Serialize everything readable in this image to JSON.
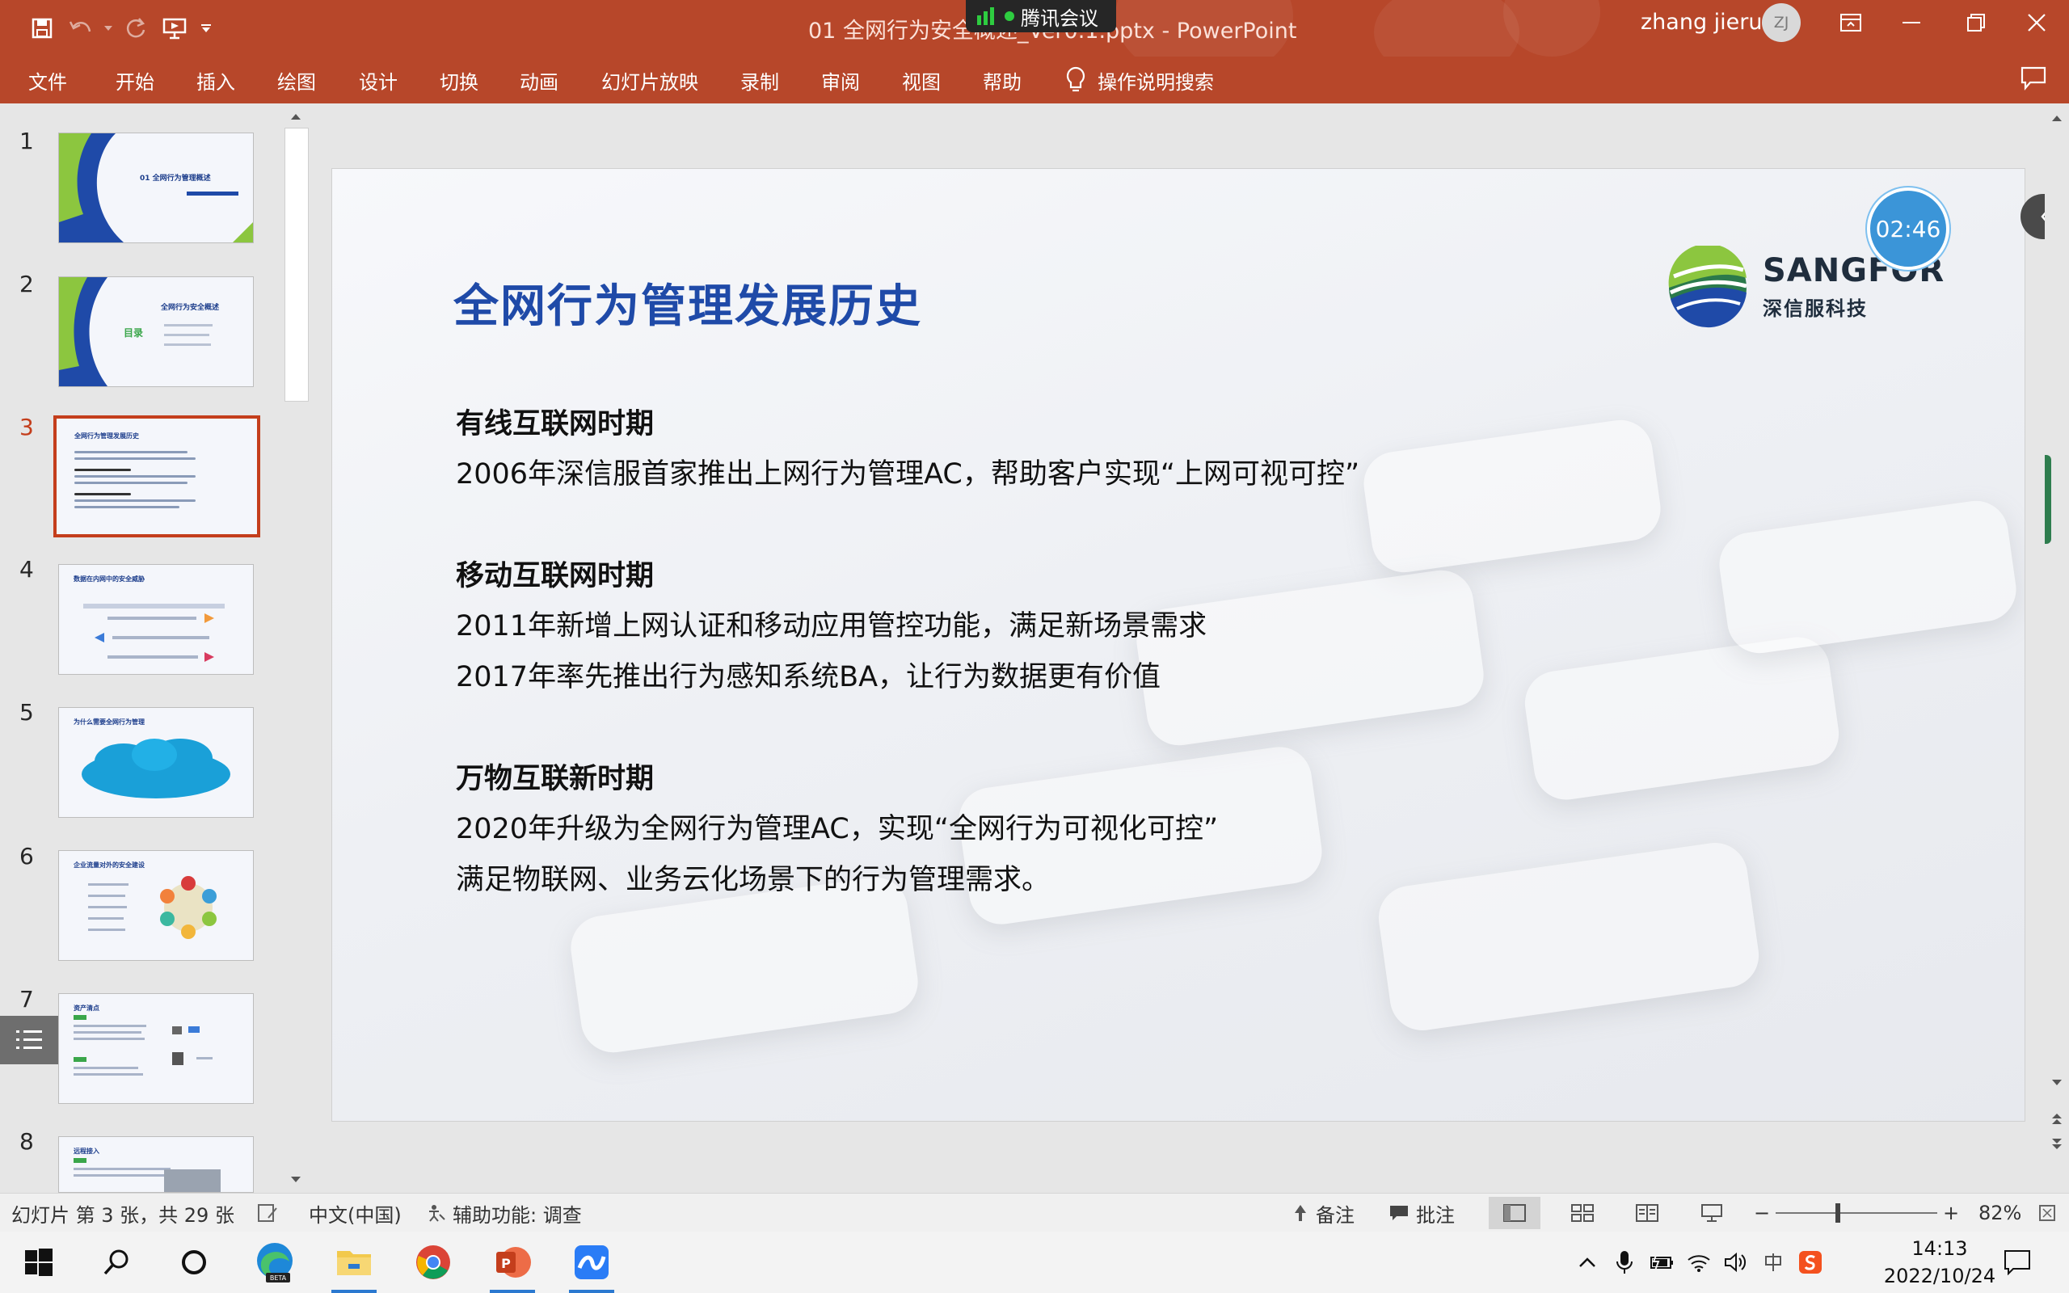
{
  "app": {
    "document_title": "01 全网行为安全概述_Ver0.1.pptx  -  PowerPoint",
    "user_name": "zhang jieru",
    "user_initials": "ZJ",
    "meeting_badge": "腾讯会议"
  },
  "menu": {
    "tabs": [
      "文件",
      "开始",
      "插入",
      "绘图",
      "设计",
      "切换",
      "动画",
      "幻灯片放映",
      "录制",
      "审阅",
      "视图",
      "帮助"
    ],
    "search_help": "操作说明搜索"
  },
  "thumbnails": [
    {
      "num": "1",
      "title": "01 全网行为管理概述"
    },
    {
      "num": "2",
      "title": "全网行为安全概述",
      "subtitle": "目录"
    },
    {
      "num": "3",
      "title": "全网行为管理发展历史"
    },
    {
      "num": "4",
      "title": "数据在内网中的安全威胁"
    },
    {
      "num": "5",
      "title": "为什么需要全网行为管理"
    },
    {
      "num": "6",
      "title": "企业流量对外的安全建设"
    },
    {
      "num": "7",
      "title": "资产清点"
    },
    {
      "num": "8",
      "title": "远程接入"
    }
  ],
  "active_slide": 3,
  "slide": {
    "title": "全网行为管理发展历史",
    "brand_name": "SANGFOR",
    "brand_cn": "深信服科技",
    "sections": [
      {
        "heading": "有线互联网时期",
        "lines": [
          "2006年深信服首家推出上网行为管理AC，帮助客户实现“上网可视可控”"
        ]
      },
      {
        "heading": "移动互联网时期",
        "lines": [
          "2011年新增上网认证和移动应用管控功能，满足新场景需求",
          "2017年率先推出行为感知系统BA，让行为数据更有价值"
        ]
      },
      {
        "heading": "万物互联新时期",
        "lines": [
          "2020年升级为全网行为管理AC，实现“全网行为可视化可控”",
          "满足物联网、业务云化场景下的行为管理需求。"
        ]
      }
    ]
  },
  "timer": "02:46",
  "status": {
    "slide_info": "幻灯片 第 3 张，共 29 张",
    "language": "中文(中国)",
    "accessibility": "辅助功能: 调查",
    "notes": "备注",
    "comments": "批注",
    "zoom_minus": "−",
    "zoom_plus": "+",
    "zoom": "82%"
  },
  "taskbar": {
    "time": "14:13",
    "date": "2022/10/24"
  },
  "colors": {
    "ppt_accent": "#b7472a",
    "active_thumb": "#c43e1c",
    "slide_title": "#1f4aa8",
    "timer": "#3b95d8"
  }
}
